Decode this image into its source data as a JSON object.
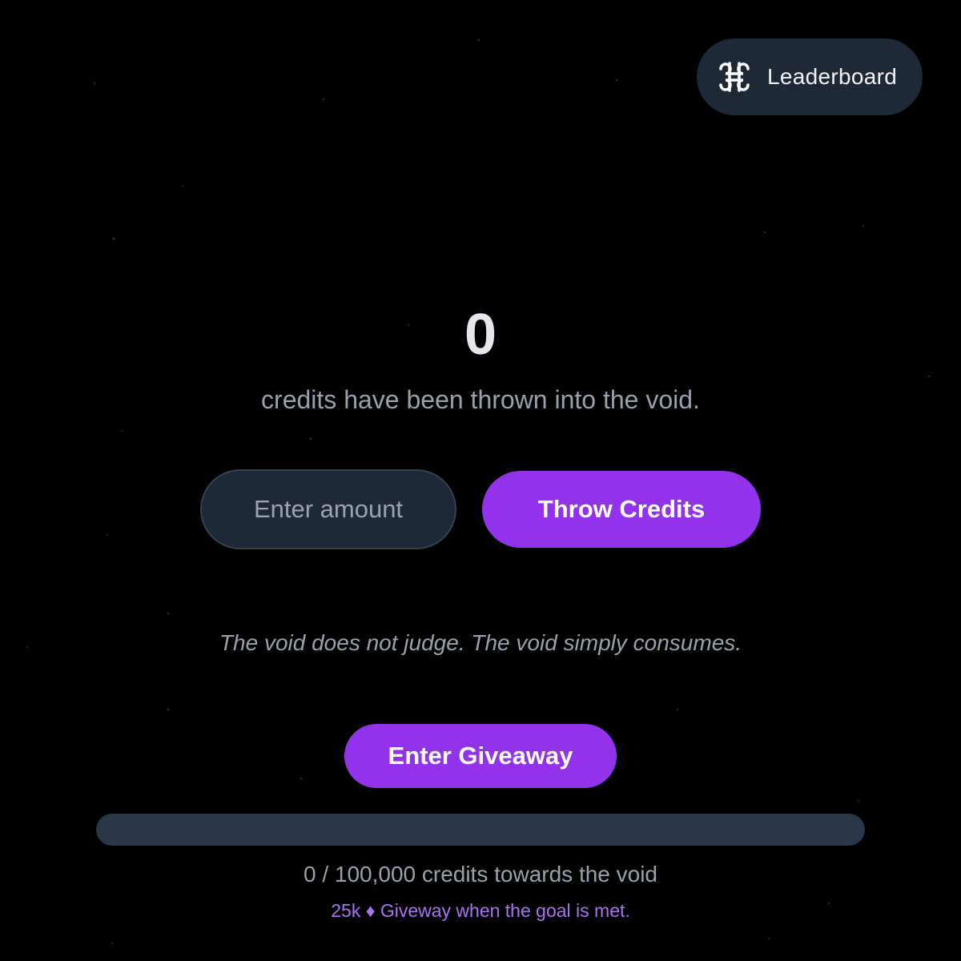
{
  "header": {
    "leaderboard_label": "Leaderboard",
    "leaderboard_icon": "command-icon"
  },
  "main": {
    "counter_value": "0",
    "subtitle": "credits have been thrown into the void.",
    "amount_input": {
      "value": "",
      "placeholder": "Enter amount"
    },
    "throw_label": "Throw Credits",
    "quote": "The void does not judge. The void simply consumes.",
    "giveaway_label": "Enter Giveaway"
  },
  "progress": {
    "current": 0,
    "goal": 100000,
    "fraction": 0,
    "text": "0 / 100,000 credits towards the void",
    "note": "25k ♦ Giveway when the goal is met."
  },
  "colors": {
    "background": "#000000",
    "accent": "#9232ea",
    "surface": "#1e2938",
    "track": "#2b3748",
    "note": "#a872f2"
  }
}
